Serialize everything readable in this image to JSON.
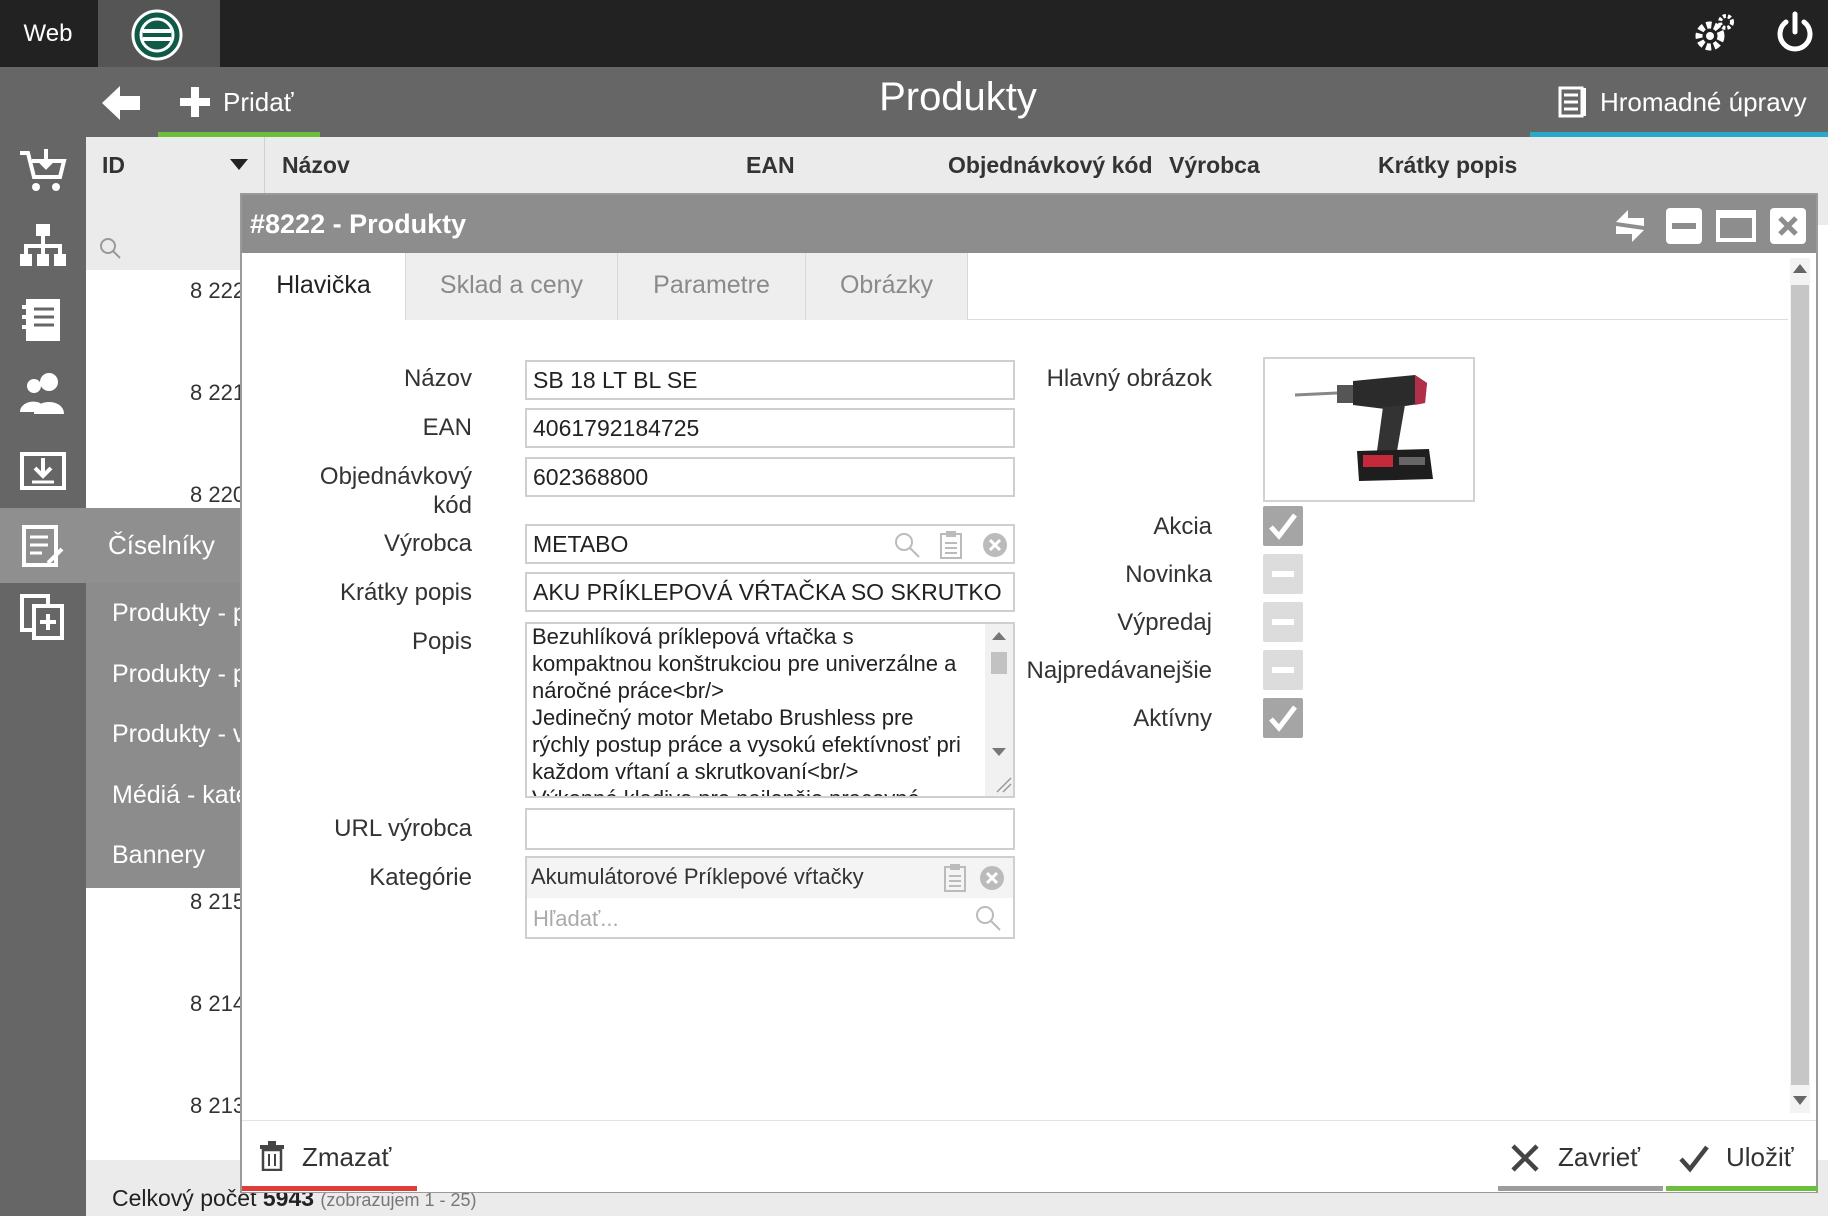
{
  "topbar": {
    "web_label": "Web"
  },
  "toolbar": {
    "add_label": "Pridať",
    "page_title": "Produkty",
    "bulk_label": "Hromadné úpravy"
  },
  "sidebar": {
    "active_menu": "Číselníky",
    "submenu": [
      "Produkty - p",
      "Produkty - p",
      "Produkty - v",
      "Médiá - kate",
      "Bannery"
    ]
  },
  "table": {
    "columns": [
      "ID",
      "Názov",
      "EAN",
      "Objednávkový kód",
      "Výrobca",
      "Krátky popis"
    ],
    "row_ids": [
      "8 222",
      "8 221",
      "8 220",
      "8 215",
      "8 214",
      "8 213"
    ],
    "footer": {
      "total_label": "Celkový počet",
      "total_value": "5943",
      "showing": "(zobrazujem 1 - 25)"
    }
  },
  "modal": {
    "title": "#8222 - Produkty",
    "tabs": [
      "Hlavička",
      "Sklad a ceny",
      "Parametre",
      "Obrázky"
    ],
    "active_tab": "Hlavička",
    "fields": {
      "nazov": {
        "label": "Názov",
        "value": "SB 18 LT BL SE"
      },
      "ean": {
        "label": "EAN",
        "value": "4061792184725"
      },
      "objednavkovy_kod": {
        "label_1": "Objednávkový",
        "label_2": "kód",
        "value": "602368800"
      },
      "vyrobca": {
        "label": "Výrobca",
        "value": "METABO"
      },
      "kratky_popis": {
        "label": "Krátky popis",
        "value": "AKU PRÍKLEPOVÁ VŔTAČKA SO SKRUTKO"
      },
      "popis": {
        "label": "Popis",
        "lines": [
          "Bezuhlíková príklepová vŕtačka s",
          "kompaktnou konštrukciou pre univerzálne a",
          "náročné práce<br/>",
          "Jedinečný motor Metabo Brushless pre",
          "rýchly postup práce a vysokú efektívnosť pri",
          "každom vŕtaní a skrutkovaní<br/>",
          "Výkonné kladivo pre najlepšie pracovné"
        ]
      },
      "url_vyrobca": {
        "label": "URL výrobca",
        "value": ""
      },
      "kategorie": {
        "label": "Kategórie",
        "value": "Akumulátorové Príklepové vŕtačky",
        "search_placeholder": "Hľadať..."
      }
    },
    "right": {
      "image_label": "Hlavný obrázok",
      "flags": [
        {
          "label": "Akcia",
          "checked": true
        },
        {
          "label": "Novinka",
          "checked": false
        },
        {
          "label": "Výpredaj",
          "checked": false
        },
        {
          "label": "Najpredávanejšie",
          "checked": false
        },
        {
          "label": "Aktívny",
          "checked": true
        }
      ]
    },
    "footer": {
      "delete_label": "Zmazať",
      "close_label": "Zavrieť",
      "save_label": "Uložiť"
    }
  },
  "colors": {
    "accent_green": "#6cbf3c",
    "accent_blue": "#29a8c9",
    "danger_red": "#e03c3c"
  }
}
